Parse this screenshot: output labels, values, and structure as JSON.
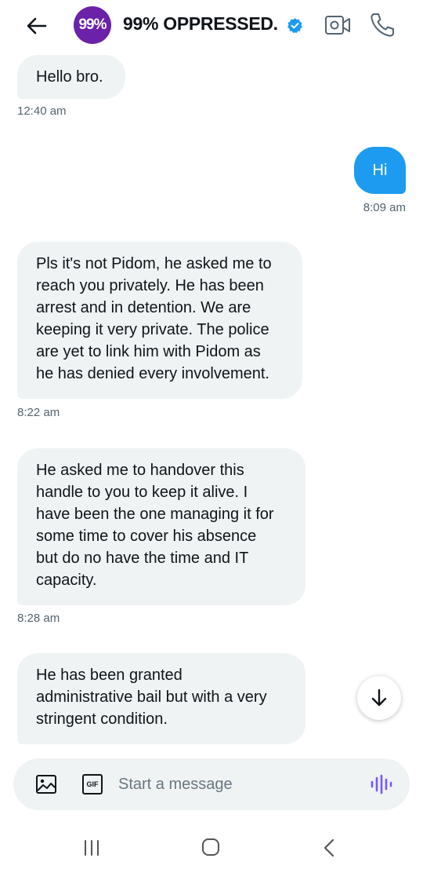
{
  "header": {
    "avatar_text": "99%",
    "title": "99% OPPRESSED.",
    "verified": true,
    "icons": [
      "back-arrow-icon",
      "verified-badge-icon",
      "video-call-icon",
      "phone-call-icon"
    ]
  },
  "messages": [
    {
      "direction": "incoming",
      "text": "Hello bro.",
      "time": "12:40 am"
    },
    {
      "direction": "outgoing",
      "text": "Hi",
      "time": "8:09 am"
    },
    {
      "direction": "incoming",
      "text": "Pls it's not Pidom, he asked me to\nreach you privately. He has been\narrest and in detention. We are\nkeeping it very private. The police\nare yet to link him with Pidom as\nhe has denied every involvement.",
      "time": "8:22 am"
    },
    {
      "direction": "incoming",
      "text": "He asked me to handover this\nhandle to you to keep it alive. I\nhave been the one managing it for\nsome time to cover his absence\nbut do no have the time and IT\ncapacity.",
      "time": "8:28 am"
    },
    {
      "direction": "incoming",
      "text": "He has been granted\nadministrative bail but with a very\nstringent condition.",
      "time": ""
    }
  ],
  "composer": {
    "placeholder": "Start a message",
    "value": "",
    "gif_label": "GIF"
  },
  "colors": {
    "accent": "#1d9bf0",
    "incoming_bubble": "#eff3f4",
    "avatar": "#6b21a8",
    "voice_icon": "#7856ff"
  }
}
